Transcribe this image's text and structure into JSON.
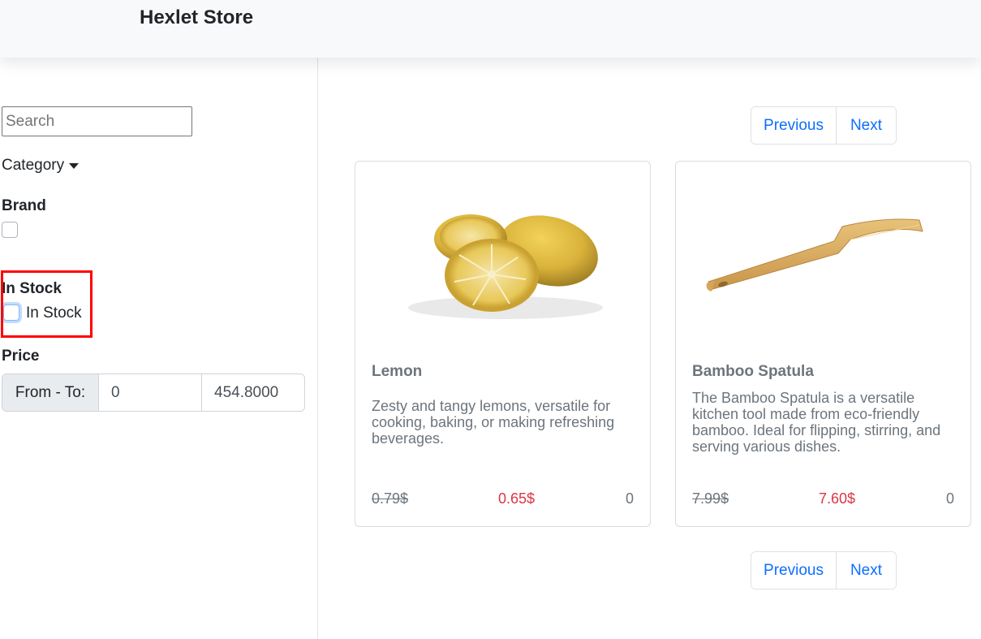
{
  "navbar": {
    "brand": "Hexlet Store"
  },
  "sidebar": {
    "search_placeholder": "Search",
    "category_label": "Category",
    "brand_title": "Brand",
    "in_stock_title": "In Stock",
    "in_stock_checkbox_label": "In Stock",
    "price_title": "Price",
    "price_prefix": "From - To:",
    "price_from": "0",
    "price_to": "454.8000"
  },
  "pagination": {
    "previous": "Previous",
    "next": "Next"
  },
  "products": [
    {
      "title": "Lemon",
      "description": "Zesty and tangy lemons, versatile for cooking, baking, or making refreshing beverages.",
      "old_price": "0.79$",
      "new_price": "0.65$",
      "quantity": "0"
    },
    {
      "title": "Bamboo Spatula",
      "description": "The Bamboo Spatula is a versatile kitchen tool made from eco-friendly bamboo. Ideal for flipping, stirring, and serving various dishes.",
      "old_price": "7.99$",
      "new_price": "7.60$",
      "quantity": "0"
    }
  ],
  "colors": {
    "link": "#0d6efd",
    "sale_price": "#dc3545",
    "highlight": "#ff0000",
    "navbar_bg": "#f8f9fa"
  },
  "icons": {
    "category_toggle": "caret-down-icon"
  }
}
